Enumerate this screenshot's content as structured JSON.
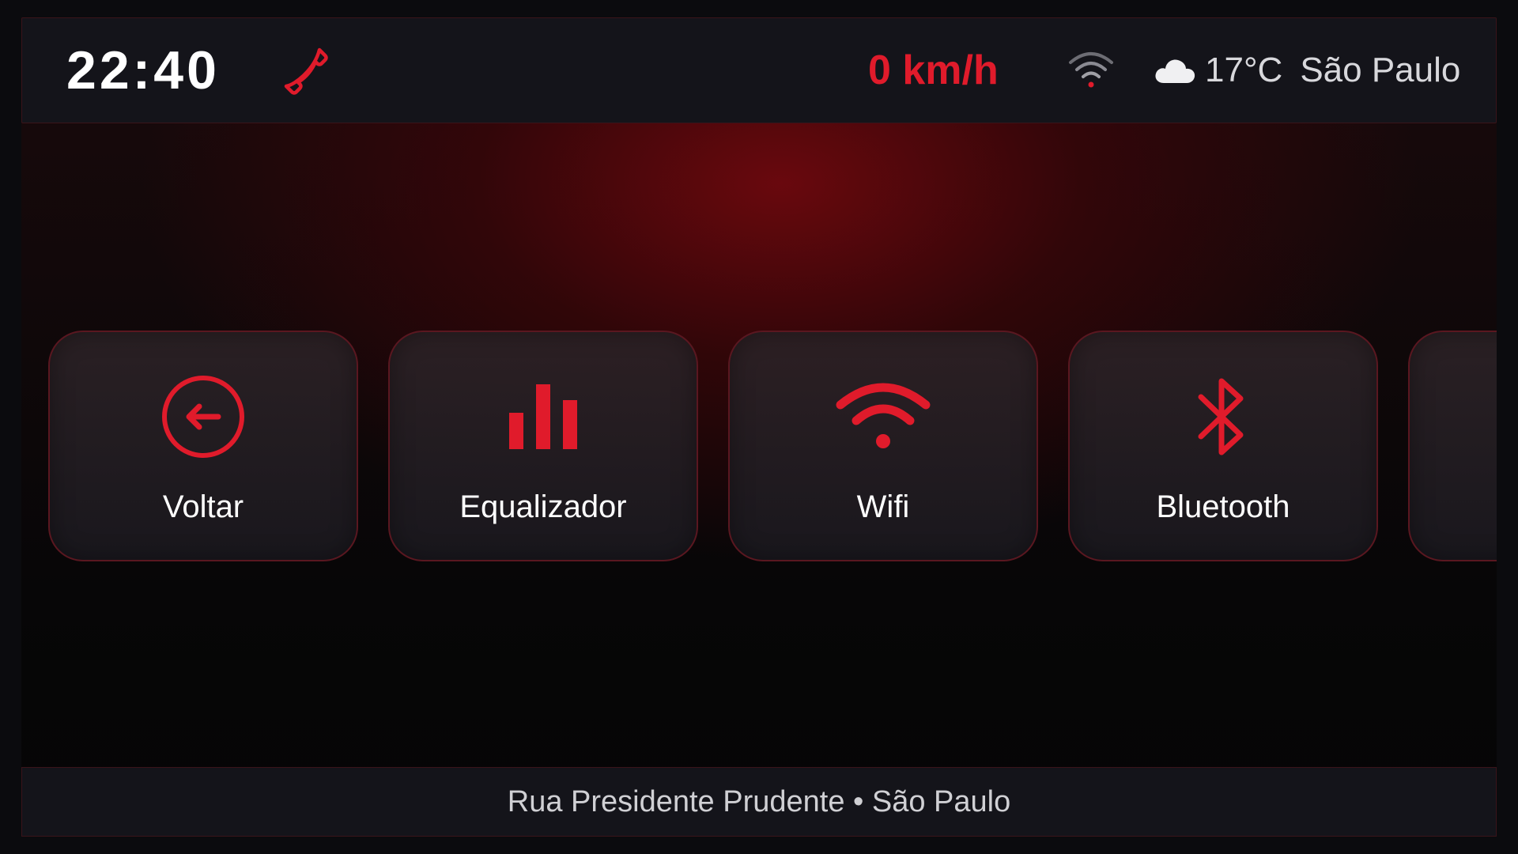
{
  "header": {
    "time": "22:40",
    "speed": "0 km/h",
    "weather": {
      "icon": "cloud-icon",
      "temperature": "17°C",
      "city": "São Paulo"
    },
    "icons": [
      "phone-icon",
      "wifi-status-icon"
    ]
  },
  "tiles": [
    {
      "label": "Voltar",
      "icon": "back-arrow-icon"
    },
    {
      "label": "Equalizador",
      "icon": "equalizer-icon"
    },
    {
      "label": "Wifi",
      "icon": "wifi-icon"
    },
    {
      "label": "Bluetooth",
      "icon": "bluetooth-icon"
    }
  ],
  "footer": {
    "location": "Rua Presidente Prudente • São Paulo"
  },
  "colors": {
    "accent": "#e01b2b",
    "bar_background": "#14141a",
    "tile_border": "#5a1720"
  }
}
